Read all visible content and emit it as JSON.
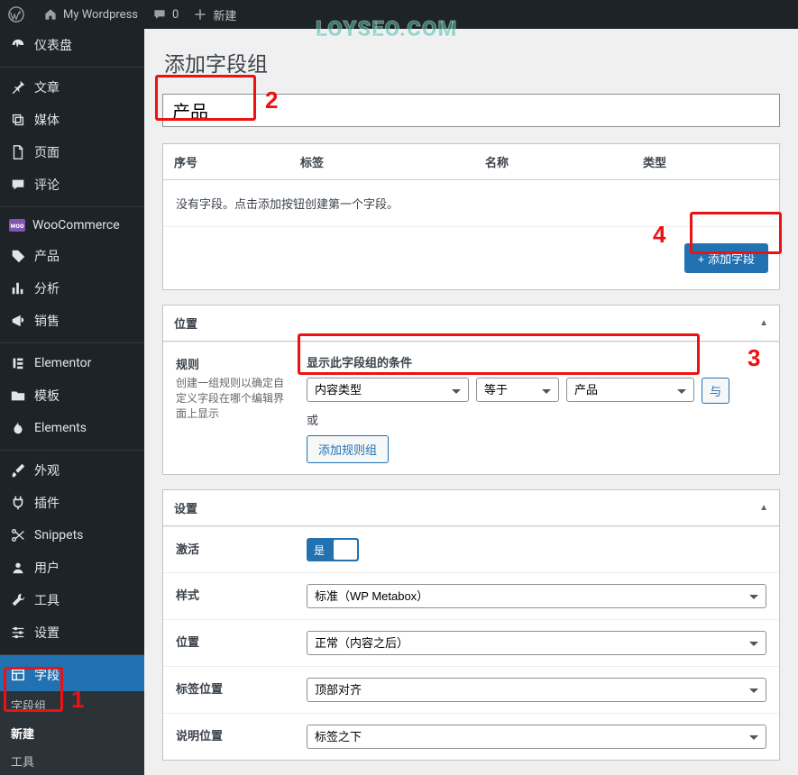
{
  "adminbar": {
    "site_title": "My Wordpress",
    "comments_count": "0",
    "new_label": "新建"
  },
  "menu": {
    "items": [
      {
        "label": "仪表盘"
      },
      {
        "label": "文章"
      },
      {
        "label": "媒体"
      },
      {
        "label": "页面"
      },
      {
        "label": "评论"
      },
      {
        "label": "WooCommerce"
      },
      {
        "label": "产品"
      },
      {
        "label": "分析"
      },
      {
        "label": "销售"
      },
      {
        "label": "Elementor"
      },
      {
        "label": "模板"
      },
      {
        "label": "Elements"
      },
      {
        "label": "外观"
      },
      {
        "label": "插件"
      },
      {
        "label": "Snippets"
      },
      {
        "label": "用户"
      },
      {
        "label": "工具"
      },
      {
        "label": "设置"
      },
      {
        "label": "字段"
      }
    ],
    "sub": {
      "groups": "字段组",
      "new": "新建",
      "tools": "工具"
    }
  },
  "page_title": "添加字段组",
  "group_title": "产品",
  "fields_table": {
    "col_order": "序号",
    "col_label": "标签",
    "col_name": "名称",
    "col_type": "类型",
    "empty": "没有字段。点击添加按钮创建第一个字段。",
    "add_btn": "+ 添加字段"
  },
  "location": {
    "heading": "位置",
    "rules_title": "规则",
    "rules_desc": "创建一组规则以确定自定义字段在哪个编辑界面上显示",
    "show_label": "显示此字段组的条件",
    "sel_param": "内容类型",
    "sel_op": "等于",
    "sel_val": "产品",
    "and": "与",
    "or": "或",
    "add_group": "添加规则组"
  },
  "settings": {
    "heading": "设置",
    "active_label": "激活",
    "active_on": "是",
    "style_label": "样式",
    "style_val": "标准（WP Metabox）",
    "pos_label": "位置",
    "pos_val": "正常（内容之后）",
    "labelpos_label": "标签位置",
    "labelpos_val": "顶部对齐",
    "instrpos_label": "说明位置",
    "instrpos_val": "标签之下"
  },
  "watermark": "LOYSEO.COM",
  "callouts": {
    "1": "1",
    "2": "2",
    "3": "3",
    "4": "4"
  }
}
